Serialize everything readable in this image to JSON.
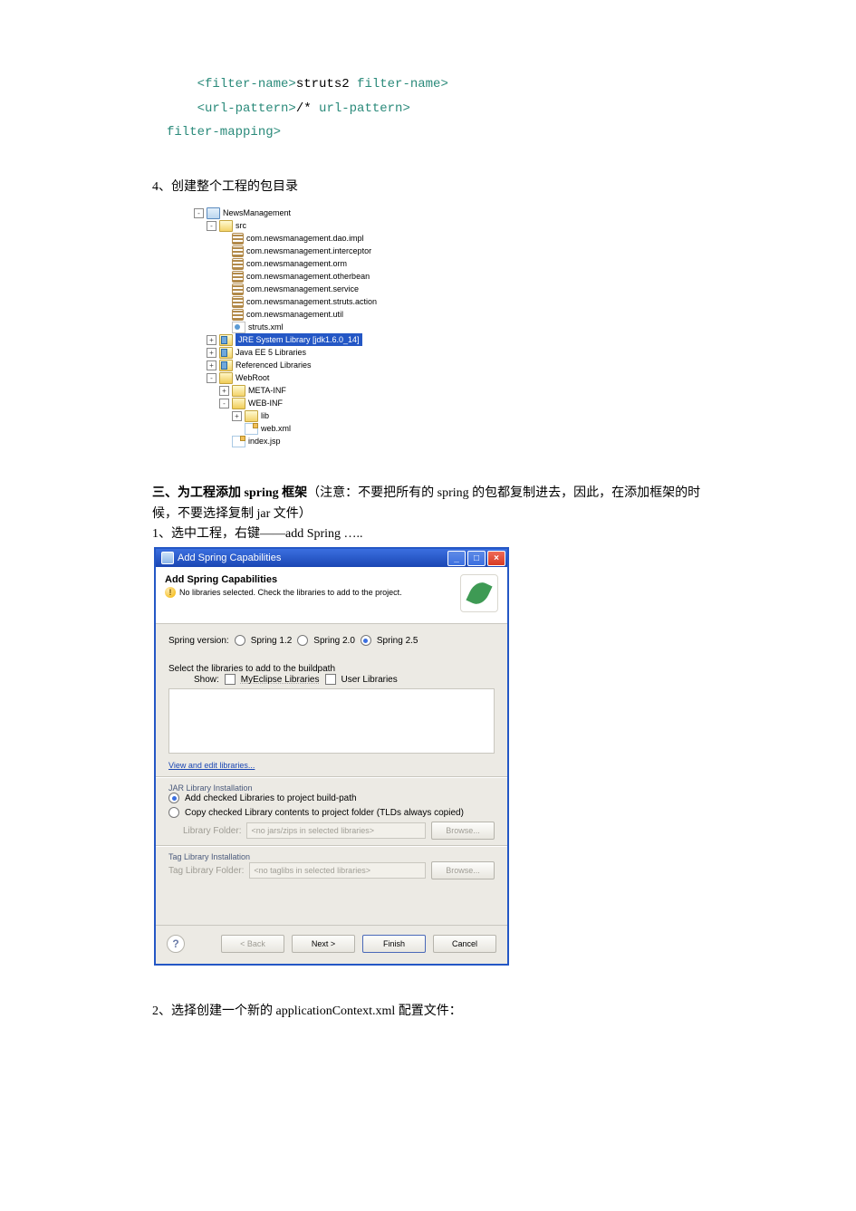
{
  "code": {
    "line1_open": "<filter-name>",
    "line1_text": "struts2",
    "line1_close": "  filter-name>",
    "line2_open": "<url-pattern>",
    "line2_text": "/*",
    "line2_close": "  url-pattern>",
    "line3": "filter-mapping>"
  },
  "heading4": "4、创建整个工程的包目录",
  "tree": {
    "project": "NewsManagement",
    "src": "src",
    "packages": [
      "com.newsmanagement.dao.impl",
      "com.newsmanagement.interceptor",
      "com.newsmanagement.orm",
      "com.newsmanagement.otherbean",
      "com.newsmanagement.service",
      "com.newsmanagement.struts.action",
      "com.newsmanagement.util"
    ],
    "struts_xml": "struts.xml",
    "jre_lib": "JRE System Library [jdk1.6.0_14]",
    "javaee_lib": "Java EE 5 Libraries",
    "ref_lib": "Referenced Libraries",
    "webroot": "WebRoot",
    "metainf": "META-INF",
    "webinf": "WEB-INF",
    "lib": "lib",
    "webxml": "web.xml",
    "indexjsp": "index.jsp"
  },
  "section3_heading_bold": "三、为工程添加 spring 框架",
  "section3_heading_rest": "（注意：不要把所有的 spring 的包都复制进去，因此，在添加框架的时候，不要选择复制 jar 文件）",
  "section3_step1": "1、选中工程，右键——add Spring …..",
  "dialog": {
    "title": "Add Spring Capabilities",
    "banner_title": "Add Spring Capabilities",
    "banner_msg": "No libraries selected. Check the libraries to add to the project.",
    "spring_version_label": "Spring version:",
    "spring_v1": "Spring 1.2",
    "spring_v2": "Spring 2.0",
    "spring_v3": "Spring 2.5",
    "select_lib_label": "Select the libraries to add to the buildpath",
    "show_label": "Show:",
    "show_myeclipse": "MyEclipse Libraries",
    "show_user": "User Libraries",
    "view_edit": "View and edit libraries...",
    "jar_install_title": "JAR Library Installation",
    "jar_opt1": "Add checked Libraries to project build-path",
    "jar_opt2": "Copy checked Library contents to project folder (TLDs always copied)",
    "library_folder_label": "Library Folder:",
    "library_folder_hint": "<no jars/zips in selected libraries>",
    "browse": "Browse...",
    "tag_install_title": "Tag Library Installation",
    "tag_folder_label": "Tag Library Folder:",
    "tag_folder_hint": "<no taglibs in selected libraries>",
    "btn_back": "< Back",
    "btn_next": "Next >",
    "btn_finish": "Finish",
    "btn_cancel": "Cancel"
  },
  "section3_step2": "2、选择创建一个新的 applicationContext.xml 配置文件："
}
